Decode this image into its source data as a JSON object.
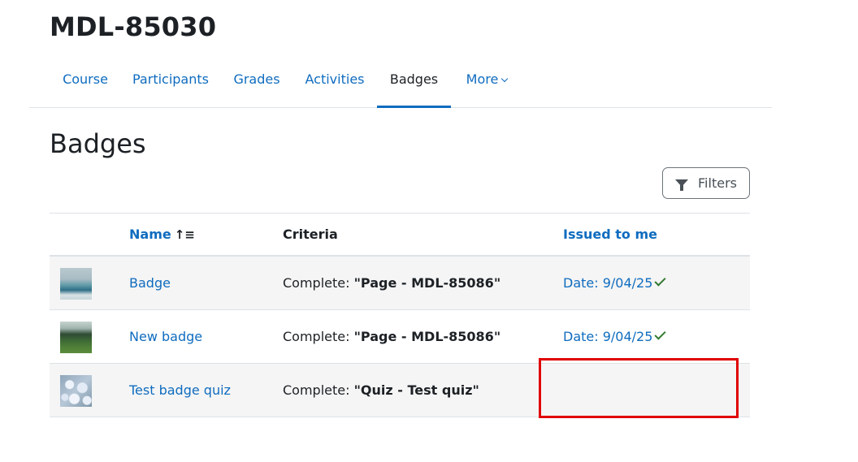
{
  "course": {
    "title": "MDL-85030"
  },
  "nav": {
    "items": [
      {
        "label": "Course"
      },
      {
        "label": "Participants"
      },
      {
        "label": "Grades"
      },
      {
        "label": "Activities"
      },
      {
        "label": "Badges",
        "active": true
      },
      {
        "label": "More"
      }
    ]
  },
  "page": {
    "heading": "Badges"
  },
  "filters": {
    "label": "Filters"
  },
  "table": {
    "headers": {
      "name": "Name",
      "criteria": "Criteria",
      "issued": "Issued to me"
    },
    "rows": [
      {
        "image": "sea-image",
        "name": "Badge",
        "criteria_prefix": "Complete: ",
        "criteria_value": "\"Page - MDL-85086\"",
        "issued": "Date: 9/04/25"
      },
      {
        "image": "forest-image",
        "name": "New badge",
        "criteria_prefix": "Complete: ",
        "criteria_value": "\"Page - MDL-85086\"",
        "issued": "Date: 9/04/25"
      },
      {
        "image": "flowers-image",
        "name": "Test badge quiz",
        "criteria_prefix": "Complete: ",
        "criteria_value": "\"Quiz - Test quiz\"",
        "issued": ""
      }
    ]
  },
  "colors": {
    "link": "#0f6cbf",
    "check": "#357a32",
    "highlight": "#e00000",
    "stripe": "#f5f5f5"
  }
}
